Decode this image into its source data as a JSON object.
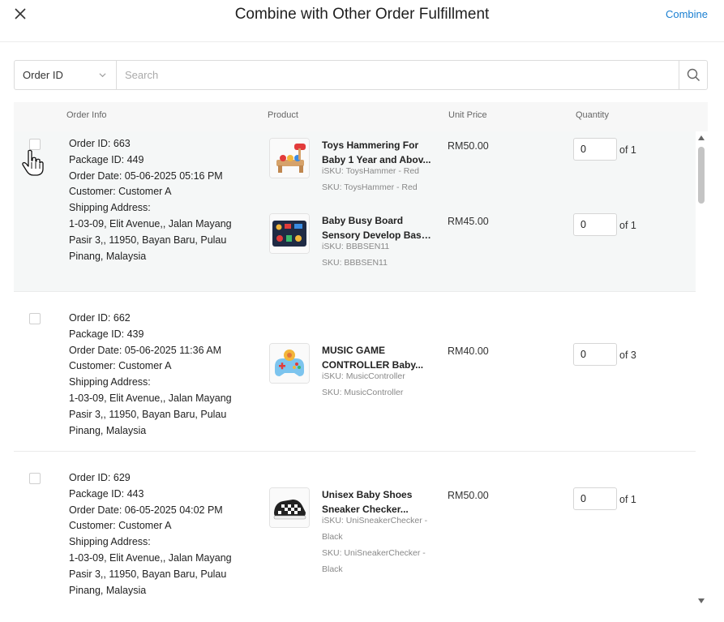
{
  "header": {
    "title": "Combine with Other Order Fulfillment",
    "combine_label": "Combine",
    "close_icon": "close-icon"
  },
  "search": {
    "field_select": "Order ID",
    "placeholder": "Search",
    "value": ""
  },
  "table": {
    "columns": {
      "order_info": "Order Info",
      "product": "Product",
      "unit_price": "Unit Price",
      "quantity": "Quantity"
    }
  },
  "orders": [
    {
      "order_id": "Order ID: 663",
      "package_id": "Package ID: 449",
      "order_date": "Order Date: 05-06-2025 05:16 PM",
      "customer": "Customer: Customer A",
      "shipping_label": "Shipping Address:",
      "address": [
        "1-03-09, Elit Avenue,, Jalan Mayang",
        "Pasir 3,, 11950, Bayan Baru, Pulau",
        "Pinang, Malaysia"
      ],
      "products": [
        {
          "name_lines": [
            "Toys Hammering For",
            "Baby 1 Year and Abov..."
          ],
          "isku": "iSKU: ToysHammer - Red",
          "sku": "SKU: ToysHammer - Red",
          "price": "RM50.00",
          "qty": "0",
          "of": "of 1"
        },
        {
          "name_lines": [
            "Baby Busy Board",
            "Sensory Develop Basi..."
          ],
          "isku": "iSKU: BBBSEN11",
          "sku": "SKU: BBBSEN11",
          "price": "RM45.00",
          "qty": "0",
          "of": "of 1"
        }
      ]
    },
    {
      "order_id": "Order ID: 662",
      "package_id": "Package ID: 439",
      "order_date": "Order Date: 05-06-2025 11:36 AM",
      "customer": "Customer: Customer A",
      "shipping_label": "Shipping Address:",
      "address": [
        "1-03-09, Elit Avenue,, Jalan Mayang",
        "Pasir 3,, 11950, Bayan Baru, Pulau",
        "Pinang, Malaysia"
      ],
      "products": [
        {
          "name_lines": [
            "MUSIC GAME",
            "CONTROLLER Baby..."
          ],
          "isku": "iSKU: MusicController",
          "sku": "SKU: MusicController",
          "price": "RM40.00",
          "qty": "0",
          "of": "of 3"
        }
      ]
    },
    {
      "order_id": "Order ID: 629",
      "package_id": "Package ID: 443",
      "order_date": "Order Date: 06-05-2025 04:02 PM",
      "customer": "Customer: Customer A",
      "shipping_label": "Shipping Address:",
      "address": [
        "1-03-09, Elit Avenue,, Jalan Mayang",
        "Pasir 3,, 11950, Bayan Baru, Pulau",
        "Pinang, Malaysia"
      ],
      "products": [
        {
          "name_lines": [
            "Unisex Baby Shoes",
            "Sneaker Checker..."
          ],
          "isku_lines": [
            "iSKU: UniSneakerChecker -",
            "Black"
          ],
          "sku_lines": [
            "SKU: UniSneakerChecker -",
            "Black"
          ],
          "price": "RM50.00",
          "qty": "0",
          "of": "of 1"
        }
      ]
    }
  ],
  "colors": {
    "accent": "#1a7fd1",
    "header_bg": "#f7f7f7",
    "hover_row_bg": "#f5f7f7"
  }
}
